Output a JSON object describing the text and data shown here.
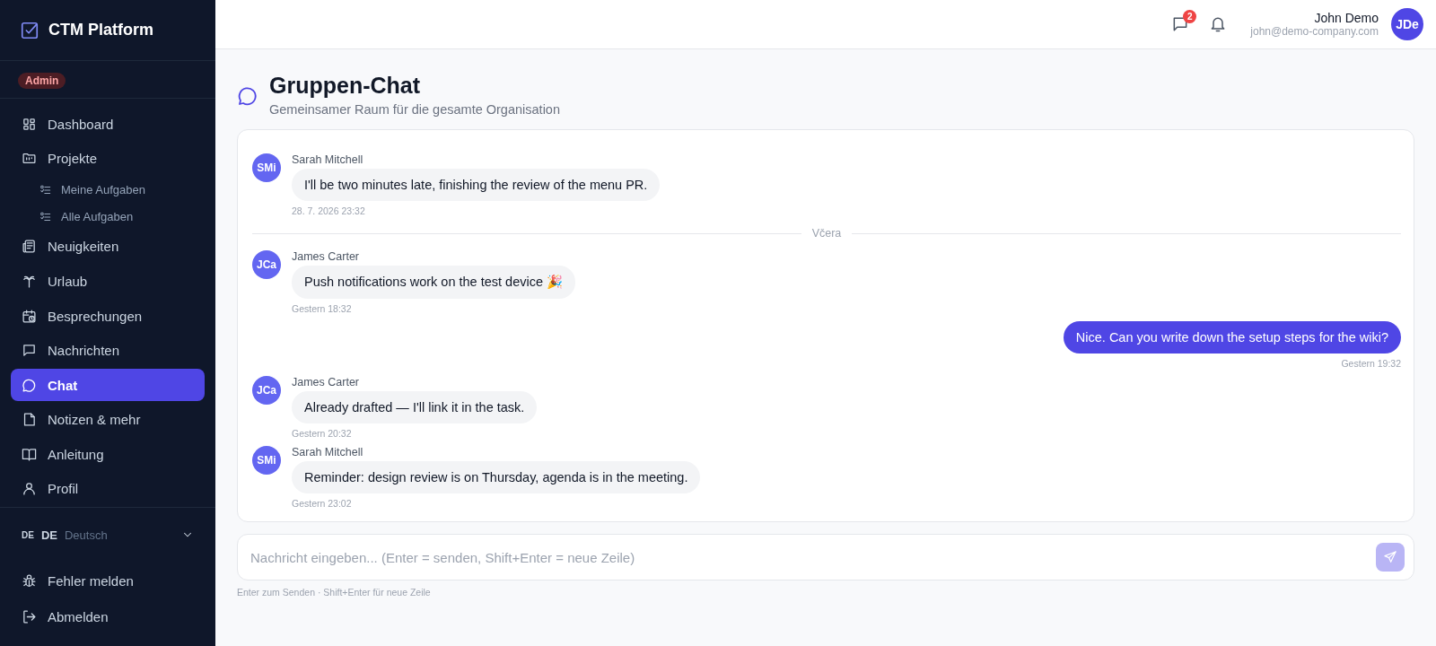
{
  "sidebar": {
    "brand": "CTM Platform",
    "role_badge": "Admin",
    "items": [
      {
        "label": "Dashboard",
        "selected": false
      },
      {
        "label": "Projekte",
        "selected": false,
        "children": [
          {
            "label": "Meine Aufgaben",
            "selected": false
          },
          {
            "label": "Alle Aufgaben",
            "selected": false
          }
        ]
      },
      {
        "label": "Neuigkeiten",
        "selected": false
      },
      {
        "label": "Urlaub",
        "selected": false
      },
      {
        "label": "Besprechungen",
        "selected": false
      },
      {
        "label": "Nachrichten",
        "selected": false
      },
      {
        "label": "Chat",
        "selected": true
      },
      {
        "label": "Notizen & mehr",
        "selected": false
      },
      {
        "label": "Anleitung",
        "selected": false
      },
      {
        "label": "Profil",
        "selected": false
      }
    ],
    "language": {
      "code": "DE",
      "short": "DE",
      "name": "Deutsch"
    },
    "footer_items": [
      {
        "label": "Fehler melden"
      },
      {
        "label": "Abmelden"
      }
    ]
  },
  "header": {
    "messages_badge": "2",
    "user_name": "John Demo",
    "user_email": "john@demo-company.com",
    "avatar": "JDe"
  },
  "page": {
    "title": "Gruppen-Chat",
    "subtitle": "Gemeinsamer Raum für die gesamte Organisation"
  },
  "messages": [
    {
      "kind": "incoming",
      "avatar": "SMi",
      "sender": "Sarah Mitchell",
      "text": "I'll be two minutes late, finishing the review of the menu PR.",
      "time": "28. 7. 2026 23:32"
    },
    {
      "kind": "divider",
      "text": "Včera"
    },
    {
      "kind": "incoming",
      "avatar": "JCa",
      "sender": "James Carter",
      "text": "Push notifications work on the test device 🎉",
      "time": "Gestern 18:32"
    },
    {
      "kind": "outgoing",
      "text": "Nice. Can you write down the setup steps for the wiki?",
      "time": "Gestern 19:32"
    },
    {
      "kind": "incoming",
      "avatar": "JCa",
      "sender": "James Carter",
      "text": "Already drafted — I'll link it in the task.",
      "time": "Gestern 20:32"
    },
    {
      "kind": "incoming",
      "avatar": "SMi",
      "sender": "Sarah Mitchell",
      "text": "Reminder: design review is on Thursday, agenda is in the meeting.",
      "time": "Gestern 23:02"
    }
  ],
  "composer": {
    "placeholder": "Nachricht eingeben... (Enter = senden, Shift+Enter = neue Zeile)",
    "hint": "Enter zum Senden · Shift+Enter für neue Zeile"
  }
}
